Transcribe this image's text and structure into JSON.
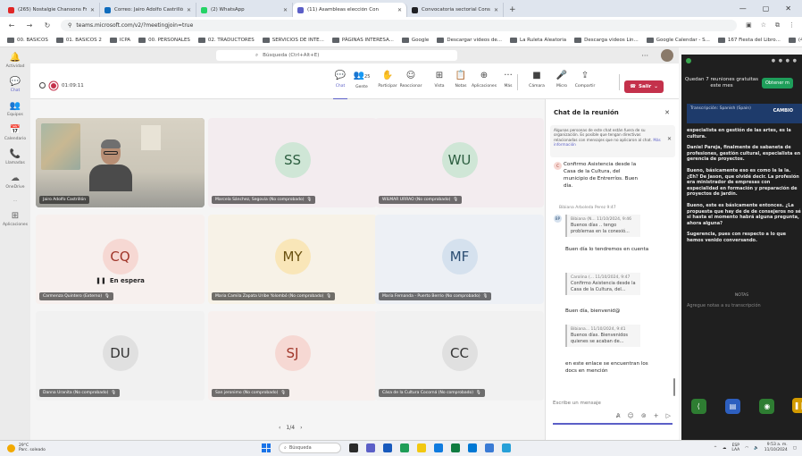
{
  "browser": {
    "tabs": [
      {
        "label": "(265) Nostalgie Chansons Fran",
        "fav": "#e02626"
      },
      {
        "label": "Correo: Jairo Adolfo Castrillón",
        "fav": "#0f6cbd"
      },
      {
        "label": "(2) WhatsApp",
        "fav": "#25d366"
      },
      {
        "label": "(11) Asambleas elección Con",
        "fav": "#5b5fc7",
        "active": true
      },
      {
        "label": "Convocatoria sectorial Consejo",
        "fav": "#202124"
      }
    ],
    "new_tab": "+",
    "url": "teams.microsoft.com/v2/?meetingjoin=true",
    "bookmarks": [
      "00. BASICOS",
      "01. BASICOS 2",
      "ICPA",
      "00. PERSONALES",
      "02. TRADUCTORES",
      "SERVICIOS DE INTE...",
      "PÁGINAS INTERESA...",
      "Google",
      "Descargar videos de...",
      "La Ruleta Aleatoria",
      "Descarga videos Lin...",
      "Google Calendar - S...",
      "167 Fiesta del Libro...",
      "(426) Nostalgie Ch..."
    ]
  },
  "teams": {
    "search_placeholder": "Búsqueda (Ctrl+Alt+E)",
    "rail": [
      {
        "label": "Actividad",
        "icon": "🔔"
      },
      {
        "label": "Chat",
        "icon": "💬",
        "active": true
      },
      {
        "label": "Equipos",
        "icon": "👥"
      },
      {
        "label": "Calendario",
        "icon": "📅"
      },
      {
        "label": "Llamadas",
        "icon": "📞"
      },
      {
        "label": "OneDrive",
        "icon": "☁"
      },
      {
        "label": "...",
        "icon": ""
      },
      {
        "label": "Aplicaciones",
        "icon": "⊞"
      }
    ]
  },
  "meeting": {
    "timer": "01:09:11",
    "tools": [
      {
        "label": "Chat",
        "icon": "💬",
        "active": true
      },
      {
        "label": "Gente",
        "icon": "👥",
        "badge": "25"
      },
      {
        "label": "Participar",
        "icon": "✋"
      },
      {
        "label": "Reaccionar",
        "icon": "☺"
      },
      {
        "label": "Vista",
        "icon": "⊞"
      },
      {
        "label": "Notas",
        "icon": "📋"
      },
      {
        "label": "Aplicaciones",
        "icon": "⊕"
      },
      {
        "label": "Más",
        "icon": "···"
      },
      {
        "label": "Cámara",
        "icon": "■"
      },
      {
        "label": "Micro",
        "icon": "🎤"
      },
      {
        "label": "Compartir",
        "icon": "⇪"
      }
    ],
    "leave_label": "Salir"
  },
  "participants": [
    {
      "name": "Jairo Adolfo Castrillón",
      "initials": "",
      "video": true,
      "bg": "#8a8f8c"
    },
    {
      "name": "Marcela Sánchez, Segovia (No comprobado)",
      "initials": "SS",
      "bg": "#f3ecef",
      "circle": "#cfe6d6",
      "fg": "#2c5e40"
    },
    {
      "name": "WILMAR URRAO (No comprobado)",
      "initials": "WU",
      "bg": "#f3ecef",
      "circle": "#cfe6d6",
      "fg": "#2c5e40"
    },
    {
      "name": "Carmenza Quintero (Externo)",
      "initials": "CQ",
      "bg": "#f7f0ee",
      "circle": "#f6d8d3",
      "fg": "#a0362a",
      "on_hold": "En espera"
    },
    {
      "name": "Maria Camila Zapata Uribe Yolombó (No comprobado)",
      "initials": "MY",
      "bg": "#f7f2e7",
      "circle": "#f9e6b8",
      "fg": "#6a5110"
    },
    {
      "name": "Maria Fernanda - Puerto Berrío (No comprobado)",
      "initials": "MF",
      "bg": "#edf0f5",
      "circle": "#d5e1ee",
      "fg": "#2b4d72"
    },
    {
      "name": "Danna Uranita (No comprobado)",
      "initials": "DU",
      "bg": "#f1f1f1",
      "circle": "#e0e0e0",
      "fg": "#333333"
    },
    {
      "name": "San jeronimo (No comprobado)",
      "initials": "SJ",
      "bg": "#f7f0ee",
      "circle": "#f6d8d3",
      "fg": "#a0362a"
    },
    {
      "name": "Cása de la Cultura Cocorná (No comprobado)",
      "initials": "CC",
      "bg": "#f1f1f1",
      "circle": "#e0e0e0",
      "fg": "#333333"
    }
  ],
  "pager": "1/4",
  "chat": {
    "title": "Chat de la reunión",
    "notice": "Algunas personas de este chat están fuera de su organización. Es posible que tengan directivas relacionadas con mensajes que no aplicaron al chat.",
    "notice_link": "Más información",
    "messages": [
      {
        "avatar": "C",
        "text": "Confirmo Asistencia desde la Casa de la Cultura, del municipio de Entrerríos. Buen día."
      },
      {
        "sender": "Bibiana Arboleda Perez  9:47"
      },
      {
        "avatar": "BP",
        "quote_head": "Bibiana (N... 11/10/2024, 9:46",
        "quote_body": "Buenos días .. tengo problemas en la conexió...",
        "text": "Buen día lo tendremos en cuenta"
      },
      {
        "quote_head": "Carolina (... 11/10/2024, 9:47",
        "quote_body": "Confirmo Asistencia desde la Casa de la Cultura, del...",
        "text": "Buen día, bienvenid@"
      },
      {
        "quote_head": "Bibiana... 11/10/2024, 9:41",
        "quote_body": "Buenos días. Bienvenidos quienes se acaban de...",
        "text": "en este enlace se encuentran los docs en mención"
      }
    ],
    "compose_placeholder": "Escribe un mensaje"
  },
  "transcript_panel": {
    "promo": "Quedan 7 reuniones gratuitas este mes",
    "promo_button": "Obtener m",
    "lang": "Transcripción: Spanish (Spain)",
    "change": "CAMBIO",
    "paragraphs": [
      "especialista en gestión de las artes, es la cultura.",
      "Daniel Pareja, finalmente de sabaneta de profesiones, gestión cultural, especialista en gerencia de proyectos.",
      "Bueno, básicamente eso es como la la la. ¿Eh? De Jason, que olvidé decir. La profesión era ministrador de empresas con especialidad en formación y preparación de proyectos de jardín.",
      "Bueno, este es básicamente entonces. ¿La propuesta que hay de de de consejeros no sé si hasta el momento habrá alguna pregunta, ahora alguna?",
      "Sugerencia, pues con respecto a lo que hemos venido conversando."
    ],
    "notes_label": "NOTAS",
    "notes_placeholder": "Agregue notas a su transcripción"
  },
  "taskbar": {
    "weather_temp": "29°C",
    "weather_text": "Parc. soleado",
    "search": "Búsqueda",
    "lang": "ESP",
    "lang2": "LAA",
    "time": "9:53 a. m.",
    "date": "11/10/2024"
  }
}
